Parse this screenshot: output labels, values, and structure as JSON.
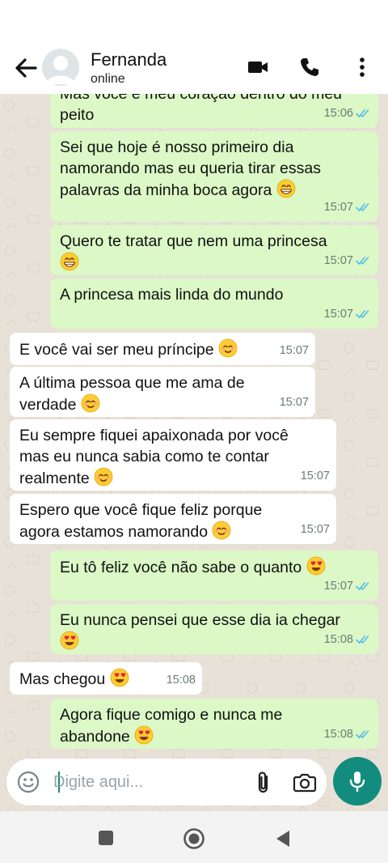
{
  "header": {
    "contact_name": "Fernanda",
    "status": "online"
  },
  "messages": [
    {
      "dir": "out",
      "text": "Mas você é meu coração dentro do meu\npeito",
      "time": "15:06",
      "ticks": "read"
    },
    {
      "dir": "out",
      "text": "Sei que hoje é nosso primeiro dia\nnamorando mas eu queria tirar essas\npalavras da minha boca agora",
      "emoji": "grinning",
      "time": "15:07",
      "ticks": "read"
    },
    {
      "dir": "out",
      "text": "Quero te tratar que nem uma princesa\n",
      "emoji": "grinning",
      "time": "15:07",
      "ticks": "read"
    },
    {
      "dir": "out",
      "text": "A princesa mais linda do mundo",
      "time": "15:07",
      "ticks": "read"
    },
    {
      "dir": "in",
      "text": "E você vai ser meu príncipe",
      "emoji": "smiling",
      "time": "15:07"
    },
    {
      "dir": "in",
      "text": "A última pessoa que me ama de\nverdade",
      "emoji": "smiling",
      "time": "15:07"
    },
    {
      "dir": "in",
      "text": "Eu sempre fiquei apaixonada por você\nmas eu nunca sabia como te contar\nrealmente",
      "emoji": "smiling",
      "time": "15:07"
    },
    {
      "dir": "in",
      "text": "Espero que você fique feliz porque\nagora estamos namorando",
      "emoji": "smiling",
      "time": "15:07"
    },
    {
      "dir": "out",
      "text": "Eu tô feliz você não sabe o quanto",
      "emoji": "heart-eyes",
      "time": "15:07",
      "ticks": "read"
    },
    {
      "dir": "out",
      "text": "Eu nunca pensei que esse dia ia chegar\n",
      "emoji": "heart-eyes",
      "time": "15:08",
      "ticks": "read"
    },
    {
      "dir": "in",
      "text": "Mas chegou",
      "emoji": "heart-eyes",
      "time": "15:08"
    },
    {
      "dir": "out",
      "text": "Agora fique comigo e nunca me\nabandone",
      "emoji": "heart-eyes",
      "time": "15:08",
      "ticks": "read"
    }
  ],
  "composer": {
    "placeholder": "Digite aqui..."
  },
  "icons": {
    "back": "arrow-left-icon",
    "video": "video-call-icon",
    "call": "phone-icon",
    "menu": "more-vert-icon",
    "emoji": "emoji-icon",
    "attach": "paperclip-icon",
    "camera": "camera-icon",
    "mic": "microphone-icon"
  },
  "colors": {
    "accent": "#128c7e",
    "outgoing_bubble": "#dbf8c6",
    "incoming_bubble": "#ffffff",
    "chat_background": "#e8e1d7",
    "read_ticks": "#53bdeb"
  }
}
